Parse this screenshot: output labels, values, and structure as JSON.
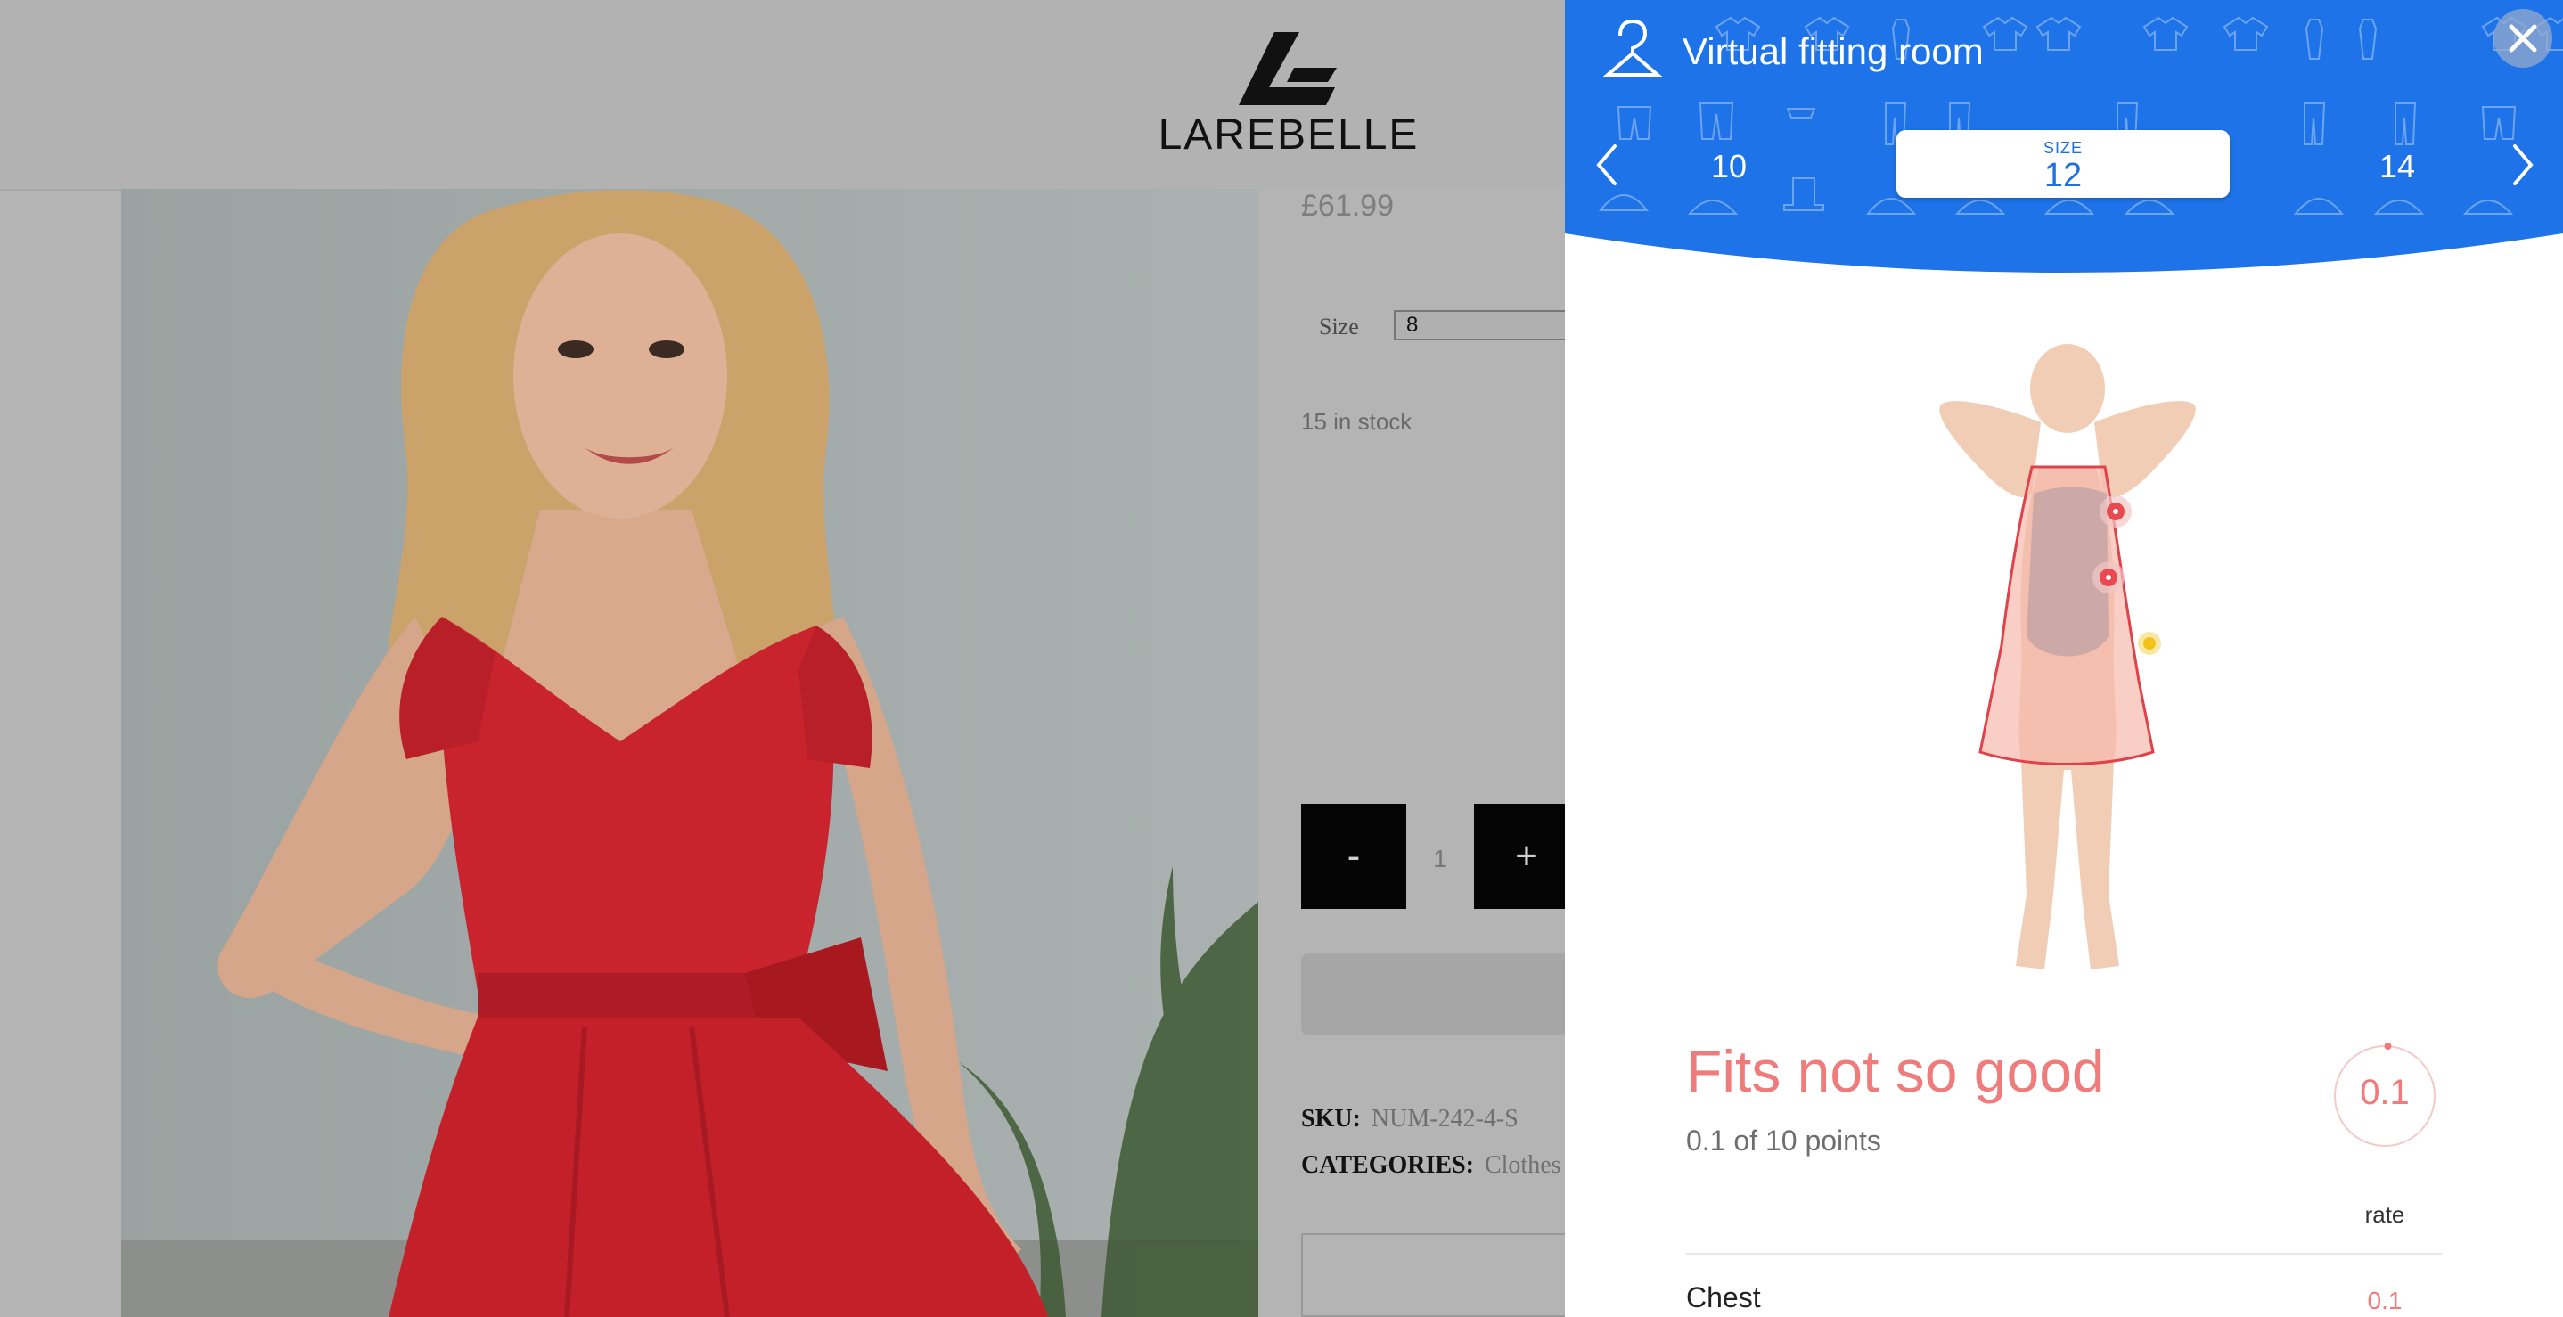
{
  "shop": {
    "logo_text": "LAREBELLE",
    "price": "£61.99",
    "size_label": "Size",
    "size_value": "8",
    "stock": "15 in stock",
    "qty_minus": "-",
    "qty_value": "1",
    "qty_plus": "+",
    "sku_label": "SKU:",
    "sku_value": "NUM-242-4-S",
    "categories_label": "CATEGORIES:",
    "categories_value": "Clothes"
  },
  "fitting_room": {
    "title": "Virtual fitting room",
    "close_label": "✕",
    "size_prev": "10",
    "size_selected_label": "SIZE",
    "size_selected": "12",
    "size_next": "14",
    "fit_title": "Fits not so good",
    "fit_points": "0.1 of 10 points",
    "rate_value": "0.1",
    "rate_score": 0.1,
    "rate_max": 10,
    "rate_label": "rate",
    "measurements": [
      {
        "label": "Chest",
        "value": "0.1"
      }
    ]
  },
  "colors": {
    "panel_blue": "#1e73e8",
    "fit_red": "#ef7b7b",
    "overlay_gray": "#b4b4b4"
  }
}
